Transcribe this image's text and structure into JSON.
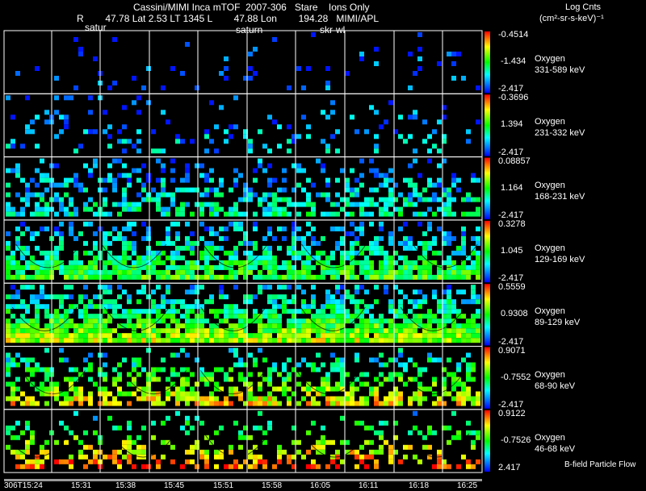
{
  "header": {
    "title": "Cassini/MIMI Inca mTOF  2007-306   Stare    Ions Only",
    "ephemeris": "R        47.78 Lat 2.53 LT 1345 L        47.88 Lon        194.28   MIMI/APL",
    "overlays": [
      "satur",
      "saturn",
      "skr-wl"
    ]
  },
  "colorbar_title": {
    "line1": "Log Cnts",
    "line2": "(cm²-sr-s-keV)⁻¹"
  },
  "footer_label": "B-field Particle Flow",
  "time_ticks": [
    "306T15:24",
    "15:31",
    "15:38",
    "15:45",
    "15:51",
    "15:58",
    "16:05",
    "16:11",
    "16:18",
    "16:25"
  ],
  "colors": {
    "background": "#000000",
    "grid": "#ffffff",
    "bottom_bar": "#9a9a9a"
  },
  "chart_data": {
    "type": "heatmap",
    "title": "Cassini/MIMI Inca mTOF  2007-306   Stare    Ions Only",
    "x_axis": {
      "ticks": [
        "306T15:24",
        "15:31",
        "15:38",
        "15:45",
        "15:51",
        "15:58",
        "16:05",
        "16:11",
        "16:18",
        "16:25"
      ]
    },
    "colorscale": "rainbow (blue → cyan → green → yellow → red)",
    "colorbar_label": "Log Cnts (cm²-sr-s-keV)⁻¹",
    "panels": [
      {
        "species": "Oxygen",
        "energy": "331-589 keV",
        "cb_max": "-0.4514",
        "cb_mid": "-1.434",
        "cb_min": "-2.417",
        "density": 0.05,
        "heat": 0.05
      },
      {
        "species": "Oxygen",
        "energy": "231-332 keV",
        "cb_max": "-0.3696",
        "cb_mid": "1.394",
        "cb_min": "-2.417",
        "density": 0.13,
        "heat": 0.18
      },
      {
        "species": "Oxygen",
        "energy": "168-231 keV",
        "cb_max": "0.08857",
        "cb_mid": "1.164",
        "cb_min": "-2.417",
        "density": 0.42,
        "heat": 0.3
      },
      {
        "species": "Oxygen",
        "energy": "129-169 keV",
        "cb_max": "0.3278",
        "cb_mid": "1.045",
        "cb_min": "-2.417",
        "density": 0.65,
        "heat": 0.45
      },
      {
        "species": "Oxygen",
        "energy": "89-129 keV",
        "cb_max": "0.5559",
        "cb_mid": "0.9308",
        "cb_min": "-2.417",
        "density": 0.75,
        "heat": 0.58
      },
      {
        "species": "Oxygen",
        "energy": "68-90 keV",
        "cb_max": "0.9071",
        "cb_mid": "-0.7552",
        "cb_min": "-2.417",
        "density": 0.5,
        "heat": 0.68
      },
      {
        "species": "Oxygen",
        "energy": "46-68 keV",
        "cb_max": "0.9122",
        "cb_mid": "-0.7526",
        "cb_min": "2.417",
        "density": 0.3,
        "heat": 0.8
      }
    ]
  }
}
